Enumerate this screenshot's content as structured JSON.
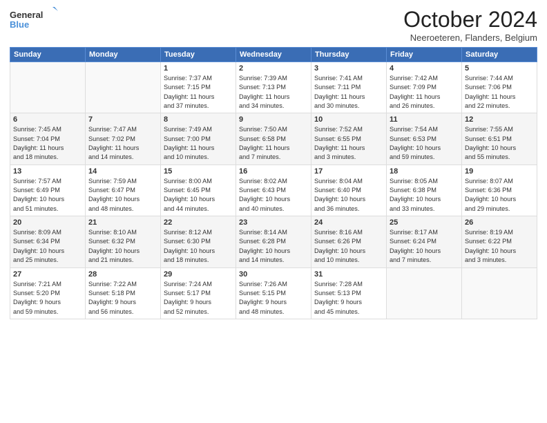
{
  "logo": {
    "line1": "General",
    "line2": "Blue"
  },
  "title": "October 2024",
  "subtitle": "Neeroeteren, Flanders, Belgium",
  "days_header": [
    "Sunday",
    "Monday",
    "Tuesday",
    "Wednesday",
    "Thursday",
    "Friday",
    "Saturday"
  ],
  "weeks": [
    [
      {
        "day": "",
        "info": ""
      },
      {
        "day": "",
        "info": ""
      },
      {
        "day": "1",
        "info": "Sunrise: 7:37 AM\nSunset: 7:15 PM\nDaylight: 11 hours\nand 37 minutes."
      },
      {
        "day": "2",
        "info": "Sunrise: 7:39 AM\nSunset: 7:13 PM\nDaylight: 11 hours\nand 34 minutes."
      },
      {
        "day": "3",
        "info": "Sunrise: 7:41 AM\nSunset: 7:11 PM\nDaylight: 11 hours\nand 30 minutes."
      },
      {
        "day": "4",
        "info": "Sunrise: 7:42 AM\nSunset: 7:09 PM\nDaylight: 11 hours\nand 26 minutes."
      },
      {
        "day": "5",
        "info": "Sunrise: 7:44 AM\nSunset: 7:06 PM\nDaylight: 11 hours\nand 22 minutes."
      }
    ],
    [
      {
        "day": "6",
        "info": "Sunrise: 7:45 AM\nSunset: 7:04 PM\nDaylight: 11 hours\nand 18 minutes."
      },
      {
        "day": "7",
        "info": "Sunrise: 7:47 AM\nSunset: 7:02 PM\nDaylight: 11 hours\nand 14 minutes."
      },
      {
        "day": "8",
        "info": "Sunrise: 7:49 AM\nSunset: 7:00 PM\nDaylight: 11 hours\nand 10 minutes."
      },
      {
        "day": "9",
        "info": "Sunrise: 7:50 AM\nSunset: 6:58 PM\nDaylight: 11 hours\nand 7 minutes."
      },
      {
        "day": "10",
        "info": "Sunrise: 7:52 AM\nSunset: 6:55 PM\nDaylight: 11 hours\nand 3 minutes."
      },
      {
        "day": "11",
        "info": "Sunrise: 7:54 AM\nSunset: 6:53 PM\nDaylight: 10 hours\nand 59 minutes."
      },
      {
        "day": "12",
        "info": "Sunrise: 7:55 AM\nSunset: 6:51 PM\nDaylight: 10 hours\nand 55 minutes."
      }
    ],
    [
      {
        "day": "13",
        "info": "Sunrise: 7:57 AM\nSunset: 6:49 PM\nDaylight: 10 hours\nand 51 minutes."
      },
      {
        "day": "14",
        "info": "Sunrise: 7:59 AM\nSunset: 6:47 PM\nDaylight: 10 hours\nand 48 minutes."
      },
      {
        "day": "15",
        "info": "Sunrise: 8:00 AM\nSunset: 6:45 PM\nDaylight: 10 hours\nand 44 minutes."
      },
      {
        "day": "16",
        "info": "Sunrise: 8:02 AM\nSunset: 6:43 PM\nDaylight: 10 hours\nand 40 minutes."
      },
      {
        "day": "17",
        "info": "Sunrise: 8:04 AM\nSunset: 6:40 PM\nDaylight: 10 hours\nand 36 minutes."
      },
      {
        "day": "18",
        "info": "Sunrise: 8:05 AM\nSunset: 6:38 PM\nDaylight: 10 hours\nand 33 minutes."
      },
      {
        "day": "19",
        "info": "Sunrise: 8:07 AM\nSunset: 6:36 PM\nDaylight: 10 hours\nand 29 minutes."
      }
    ],
    [
      {
        "day": "20",
        "info": "Sunrise: 8:09 AM\nSunset: 6:34 PM\nDaylight: 10 hours\nand 25 minutes."
      },
      {
        "day": "21",
        "info": "Sunrise: 8:10 AM\nSunset: 6:32 PM\nDaylight: 10 hours\nand 21 minutes."
      },
      {
        "day": "22",
        "info": "Sunrise: 8:12 AM\nSunset: 6:30 PM\nDaylight: 10 hours\nand 18 minutes."
      },
      {
        "day": "23",
        "info": "Sunrise: 8:14 AM\nSunset: 6:28 PM\nDaylight: 10 hours\nand 14 minutes."
      },
      {
        "day": "24",
        "info": "Sunrise: 8:16 AM\nSunset: 6:26 PM\nDaylight: 10 hours\nand 10 minutes."
      },
      {
        "day": "25",
        "info": "Sunrise: 8:17 AM\nSunset: 6:24 PM\nDaylight: 10 hours\nand 7 minutes."
      },
      {
        "day": "26",
        "info": "Sunrise: 8:19 AM\nSunset: 6:22 PM\nDaylight: 10 hours\nand 3 minutes."
      }
    ],
    [
      {
        "day": "27",
        "info": "Sunrise: 7:21 AM\nSunset: 5:20 PM\nDaylight: 9 hours\nand 59 minutes."
      },
      {
        "day": "28",
        "info": "Sunrise: 7:22 AM\nSunset: 5:18 PM\nDaylight: 9 hours\nand 56 minutes."
      },
      {
        "day": "29",
        "info": "Sunrise: 7:24 AM\nSunset: 5:17 PM\nDaylight: 9 hours\nand 52 minutes."
      },
      {
        "day": "30",
        "info": "Sunrise: 7:26 AM\nSunset: 5:15 PM\nDaylight: 9 hours\nand 48 minutes."
      },
      {
        "day": "31",
        "info": "Sunrise: 7:28 AM\nSunset: 5:13 PM\nDaylight: 9 hours\nand 45 minutes."
      },
      {
        "day": "",
        "info": ""
      },
      {
        "day": "",
        "info": ""
      }
    ]
  ]
}
